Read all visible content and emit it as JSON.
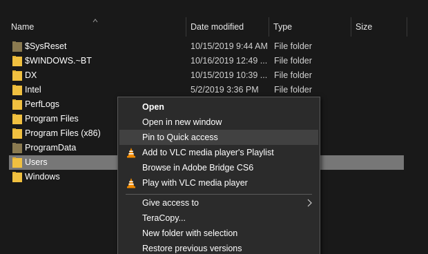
{
  "columns": {
    "name": "Name",
    "date_modified": "Date modified",
    "type": "Type",
    "size": "Size"
  },
  "rows": [
    {
      "name": "$SysReset",
      "date": "10/15/2019 9:44 AM",
      "type": "File folder",
      "icon": "folder-icon-dim"
    },
    {
      "name": "$WINDOWS.~BT",
      "date": "10/16/2019 12:49 ...",
      "type": "File folder",
      "icon": "folder-icon"
    },
    {
      "name": "DX",
      "date": "10/15/2019 10:39 ...",
      "type": "File folder",
      "icon": "folder-icon"
    },
    {
      "name": "Intel",
      "date": "5/2/2019 3:36 PM",
      "type": "File folder",
      "icon": "folder-icon"
    },
    {
      "name": "PerfLogs",
      "date": "",
      "type": "",
      "icon": "folder-icon"
    },
    {
      "name": "Program Files",
      "date": "",
      "type": "",
      "icon": "folder-icon"
    },
    {
      "name": "Program Files (x86)",
      "date": "",
      "type": "",
      "icon": "folder-icon"
    },
    {
      "name": "ProgramData",
      "date": "",
      "type": "",
      "icon": "folder-icon-dim"
    },
    {
      "name": "Users",
      "date": "",
      "type": "",
      "icon": "folder-icon"
    },
    {
      "name": "Windows",
      "date": "",
      "type": "",
      "icon": "folder-icon"
    }
  ],
  "selected_row": "Users",
  "context_menu": {
    "items": [
      {
        "label": "Open",
        "icon": "",
        "bold": true
      },
      {
        "label": "Open in new window",
        "icon": ""
      },
      {
        "label": "Pin to Quick access",
        "icon": "",
        "highlighted": true
      },
      {
        "label": "Add to VLC media player's Playlist",
        "icon": "vlc-cone-icon"
      },
      {
        "label": "Browse in Adobe Bridge CS6",
        "icon": ""
      },
      {
        "label": "Play with VLC media player",
        "icon": "vlc-cone-icon"
      },
      {
        "label": "Give access to",
        "icon": "",
        "submenu": true
      },
      {
        "label": "TeraCopy...",
        "icon": ""
      },
      {
        "label": "New folder with selection",
        "icon": ""
      },
      {
        "label": "Restore previous versions",
        "icon": ""
      }
    ]
  },
  "colors": {
    "background": "#191919",
    "folder": "#f0c040",
    "folder_dim": "#8a7a50",
    "selection": "#777777",
    "menu_bg": "#2b2b2b",
    "menu_hover": "#414141",
    "vlc_orange": "#f08a00"
  }
}
